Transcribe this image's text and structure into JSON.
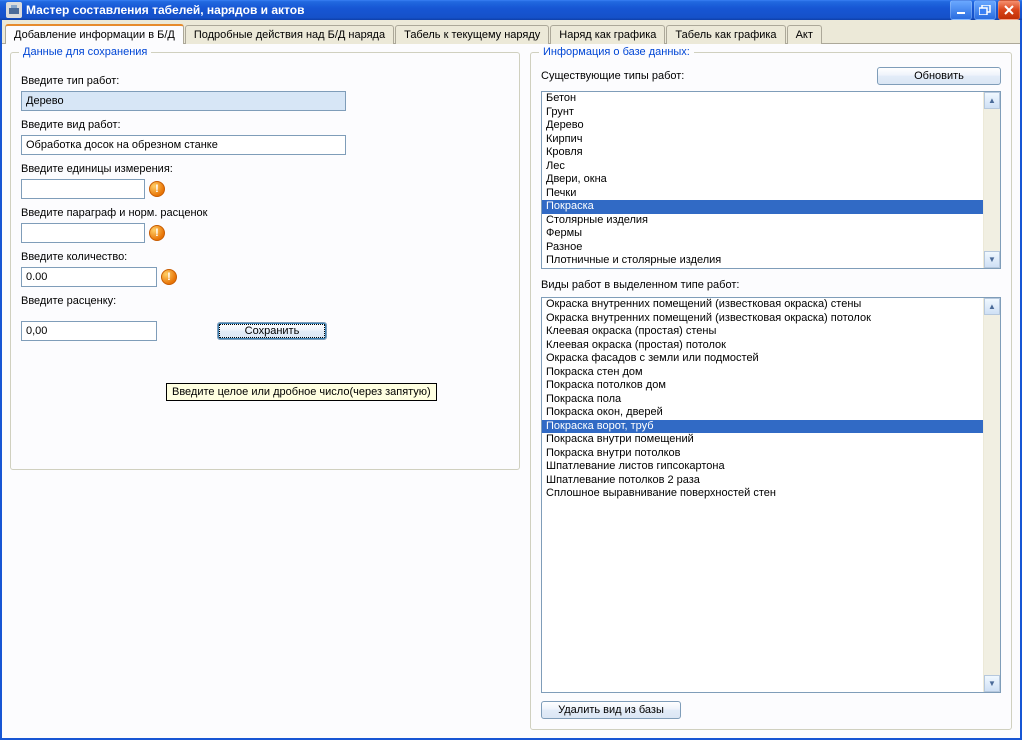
{
  "window": {
    "title": "Мастер составления табелей, нарядов и актов"
  },
  "tabs": [
    {
      "label": "Добавление информации в Б/Д",
      "active": true
    },
    {
      "label": "Подробные действия над Б/Д наряда",
      "active": false
    },
    {
      "label": "Табель к текущему наряду",
      "active": false
    },
    {
      "label": "Наряд как графика",
      "active": false
    },
    {
      "label": "Табель как графика",
      "active": false
    },
    {
      "label": "Акт",
      "active": false
    }
  ],
  "left_panel": {
    "title": "Данные для сохранения",
    "fields": {
      "type_label": "Введите тип работ:",
      "type_value": "Дерево",
      "kind_label": "Введите вид работ:",
      "kind_value": "Обработка досок на обрезном станке",
      "units_label": "Введите единицы измерения:",
      "units_value": "",
      "para_label": "Введите параграф и норм. расценок",
      "para_value": "",
      "qty_label": "Введите количество:",
      "qty_value": "0.00",
      "price_label": "Введите расценку:",
      "price_value": "0,00",
      "save_button": "Сохранить",
      "tooltip": "Введите целое или дробное число(через запятую)"
    }
  },
  "right_panel": {
    "title": "Информация о базе данных:",
    "types_label": "Существующие типы работ:",
    "refresh_button": "Обновить",
    "types": [
      {
        "label": "Бетон",
        "selected": false
      },
      {
        "label": "Грунт",
        "selected": false
      },
      {
        "label": "Дерево",
        "selected": false
      },
      {
        "label": "Кирпич",
        "selected": false
      },
      {
        "label": "Кровля",
        "selected": false
      },
      {
        "label": "Лес",
        "selected": false
      },
      {
        "label": "Двери, окна",
        "selected": false
      },
      {
        "label": "Печки",
        "selected": false
      },
      {
        "label": "Покраска",
        "selected": true
      },
      {
        "label": "Столярные изделия",
        "selected": false
      },
      {
        "label": "Фермы",
        "selected": false
      },
      {
        "label": "Разное",
        "selected": false
      },
      {
        "label": "Плотничные и столярные изделия",
        "selected": false
      }
    ],
    "kinds_label": "Виды работ в выделенном типе работ:",
    "kinds": [
      {
        "label": "Окраска внутренних помещений  (известковая окраска) стены",
        "selected": false
      },
      {
        "label": "Окраска внутренних помещений  (известковая окраска) потолок",
        "selected": false
      },
      {
        "label": "Клеевая окраска (простая) стены",
        "selected": false
      },
      {
        "label": "Клеевая окраска (простая) потолок",
        "selected": false
      },
      {
        "label": "Окраска фасадов с земли или подмостей",
        "selected": false
      },
      {
        "label": "Покраска стен дом",
        "selected": false
      },
      {
        "label": "Покраска потолков дом",
        "selected": false
      },
      {
        "label": "Покраска пола",
        "selected": false
      },
      {
        "label": "Покраска окон, дверей",
        "selected": false
      },
      {
        "label": "Покраска ворот, труб",
        "selected": true
      },
      {
        "label": "Покраска внутри помещений",
        "selected": false
      },
      {
        "label": "Покраска внутри потолков",
        "selected": false
      },
      {
        "label": "Шпатлевание листов гипсокартона",
        "selected": false
      },
      {
        "label": "Шпатлевание потолков 2 раза",
        "selected": false
      },
      {
        "label": "Сплошное выравнивание поверхностей стен",
        "selected": false
      }
    ],
    "delete_button": "Удалить вид из базы"
  }
}
